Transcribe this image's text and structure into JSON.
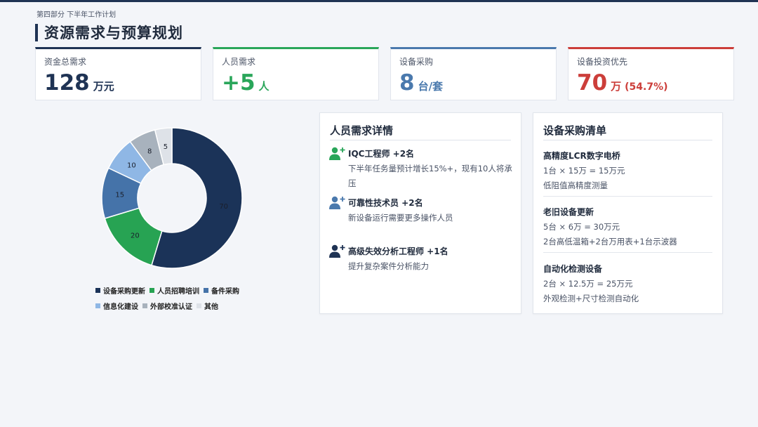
{
  "header": {
    "section_label": "第四部分 下半年工作计划",
    "title": "资源需求与预算规划"
  },
  "kpis": [
    {
      "label": "资金总需求",
      "value": "128",
      "unit": "万元",
      "note": "",
      "color": "#1f3354"
    },
    {
      "label": "人员需求",
      "value": "+5",
      "unit": "人",
      "note": "",
      "color": "#2aa65a"
    },
    {
      "label": "设备采购",
      "value": "8",
      "unit": "台/套",
      "note": "",
      "color": "#4a79ad"
    },
    {
      "label": "设备投资优先",
      "value": "70",
      "unit": "万",
      "note": "(54.7%)",
      "color": "#cc3e3a"
    }
  ],
  "chart_data": {
    "type": "pie",
    "title": "",
    "categories": [
      "设备采购更新",
      "人员招聘培训",
      "备件采购",
      "信息化建设",
      "外部校准认证",
      "其他"
    ],
    "values": [
      70,
      20,
      15,
      10,
      8,
      5
    ],
    "colors": [
      "#1b3358",
      "#27a353",
      "#4573a9",
      "#8fb7e5",
      "#a8b2bd",
      "#dee2e8"
    ],
    "donut": true,
    "data_labels": [
      "70",
      "20",
      "15",
      "10",
      "8",
      "5"
    ],
    "legend_position": "bottom"
  },
  "staff_card": {
    "title": "人员需求详情",
    "items": [
      {
        "icon": "person-add-icon",
        "name": "IQC工程师 +2名",
        "desc": "下半年任务量预计增长15%+，现有10人将承压",
        "icon_color": "#2aa65a"
      },
      {
        "icon": "person-add-icon",
        "name": "可靠性技术员 +2名",
        "desc": "新设备运行需要更多操作人员",
        "icon_color": "#4a79ad"
      },
      {
        "icon": "person-add-icon",
        "name": "高级失效分析工程师 +1名",
        "desc": "提升复杂案件分析能力",
        "icon_color": "#1f3354"
      }
    ]
  },
  "equip_card": {
    "title": "设备采购清单",
    "items": [
      {
        "name": "高精度LCR数字电桥",
        "calc": "1台 × 15万 = 15万元",
        "desc": "低阻值高精度测量"
      },
      {
        "name": "老旧设备更新",
        "calc": "5台 × 6万 = 30万元",
        "desc": "2台高低温箱+2台万用表+1台示波器"
      },
      {
        "name": "自动化检测设备",
        "calc": "2台 × 12.5万 = 25万元",
        "desc": "外观检测+尺寸检测自动化"
      }
    ]
  }
}
